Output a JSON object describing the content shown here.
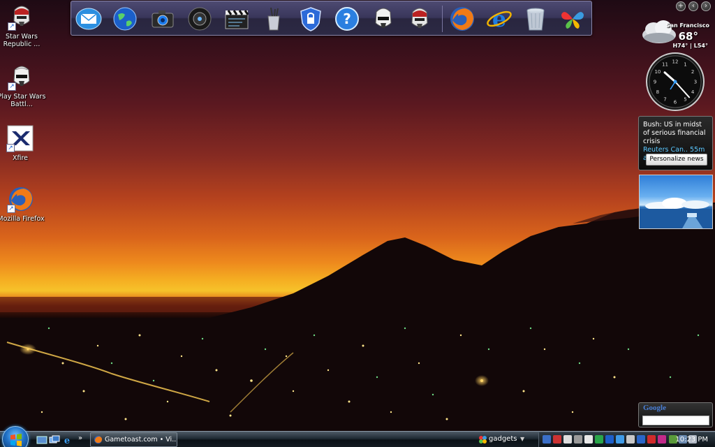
{
  "desktop": {
    "icons": [
      {
        "label": "Star Wars Republic ...",
        "icon": "clone-trooper-icon"
      },
      {
        "label": "Play Star Wars Battl...",
        "icon": "stormtrooper-icon"
      },
      {
        "label": "Xfire",
        "icon": "xfire-icon"
      },
      {
        "label": "Mozilla Firefox",
        "icon": "firefox-icon"
      }
    ]
  },
  "dock": {
    "items": [
      "mail-icon",
      "globe-icon",
      "camera-icon",
      "speaker-icon",
      "clapperboard-icon",
      "pencil-cup-icon",
      "shield-icon",
      "help-icon",
      "stormtrooper-icon",
      "clone-trooper-icon",
      "firefox-icon",
      "internet-explorer-icon",
      "recycle-bin-icon",
      "msn-butterfly-icon"
    ]
  },
  "gadgets": {
    "weather": {
      "city": "San Francisco",
      "temp": "68°",
      "hilo": "H74° | L54°"
    },
    "clock": {
      "hour": 10,
      "minute": 23
    },
    "news": {
      "headline": "Bush: US in midst of serious financial crisis",
      "source": "Reuters Can.. 55m ago",
      "button": "Personalize news"
    },
    "google": {
      "logo": "Google"
    }
  },
  "taskbar": {
    "task": "Gametoast.com • Vi...",
    "gadgets_label": "gadgets",
    "time": "10:23 PM"
  },
  "colors": {
    "taskbar": "#141b22",
    "news_source": "#5bc8ff"
  }
}
